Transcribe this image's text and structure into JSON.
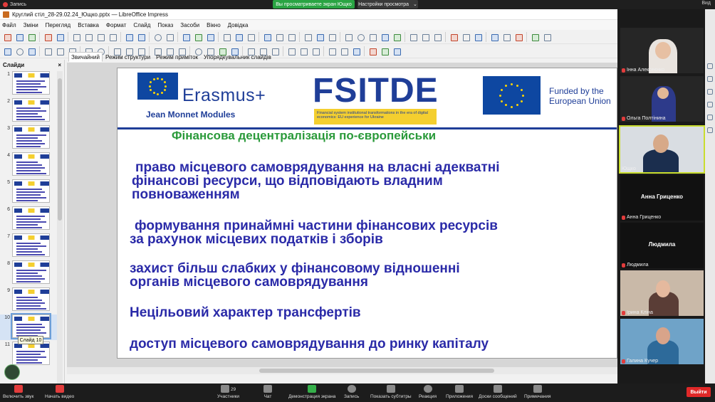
{
  "zoom_top": {
    "rec_label": "Запись",
    "viewing_label": "Вы просматриваете экран Ющко",
    "view_settings": "Настройки просмотра",
    "view_settings_caret": "⌄",
    "right_label": "Вид"
  },
  "window": {
    "title": "Круглий стіл_28-29.02.24_Ющко.pptx — LibreOffice Impress"
  },
  "menu": [
    "Файл",
    "Зміни",
    "Перегляд",
    "Вставка",
    "Формат",
    "Слайд",
    "Показ",
    "Засоби",
    "Вікно",
    "Довідка"
  ],
  "slides_pane": {
    "title": "Слайди",
    "close": "×",
    "numbers": [
      "1",
      "2",
      "3",
      "4",
      "5",
      "6",
      "7",
      "8",
      "9",
      "10",
      "11"
    ],
    "selected": 10,
    "tooltip": "Слайд 10"
  },
  "view_tabs": [
    "Звичайний",
    "Режим структури",
    "Режим приміток",
    "Упорядкувальник слайдів"
  ],
  "slide": {
    "erasmus": "Erasmus+",
    "jean_monnet": "Jean Monnet Modules",
    "fsitde": "FSITDE",
    "fsitde_sub": "Financial system institutional transformations in the era of digital economics: EU experience for Ukraine",
    "funded_1": "Funded by the",
    "funded_2": "European Union",
    "title": "Фінансова децентралізація по-європейськи",
    "bullets": [
      [
        "право місцевого самоврядування на власні адекватні",
        "фінансові ресурси, що відповідають владним",
        "повноваженням"
      ],
      [
        "формування принаймні частини фінансових ресурсів",
        "за рахунок місцевих податків і зборів"
      ],
      [
        "захист більш слабких у фінансовому відношенні",
        "органів місцевого самоврядування"
      ],
      [
        "Нецільовий характер трансфертів"
      ],
      [
        "доступ місцевого самоврядування до ринку капіталу"
      ]
    ]
  },
  "participants": [
    {
      "name": "Інна Алексеєнко",
      "muted": true
    },
    {
      "name": "Ольга Полтінина",
      "muted": true
    },
    {
      "name": "Ющко",
      "muted": false,
      "active": true
    },
    {
      "name": "Анна Гриценко",
      "muted": true,
      "big": "Анна Гриценко"
    },
    {
      "name": "Людмила",
      "muted": true,
      "big": "Людмила"
    },
    {
      "name": "Ірина Кліна",
      "muted": true
    },
    {
      "name": "Галина Кучер",
      "muted": true
    }
  ],
  "zoom_bottom": {
    "mic": "Включить звук",
    "video": "Начать видео",
    "participants": "Участники",
    "participants_count": "29",
    "chat": "Чат",
    "share": "Демонстрация экрана",
    "record": "Запись",
    "captions": "Показать субтитры",
    "reactions": "Реакция",
    "apps": "Приложения",
    "whiteboards": "Доски сообщений",
    "notes": "Примечания",
    "leave": "Выйти"
  },
  "colors": {
    "eu_blue": "#0e47a1",
    "brand_blue": "#1f3e98",
    "title_green": "#2a9a3a",
    "bullet_blue": "#2a2aa8",
    "zoom_green": "#2aa443",
    "leave_red": "#e02828"
  }
}
